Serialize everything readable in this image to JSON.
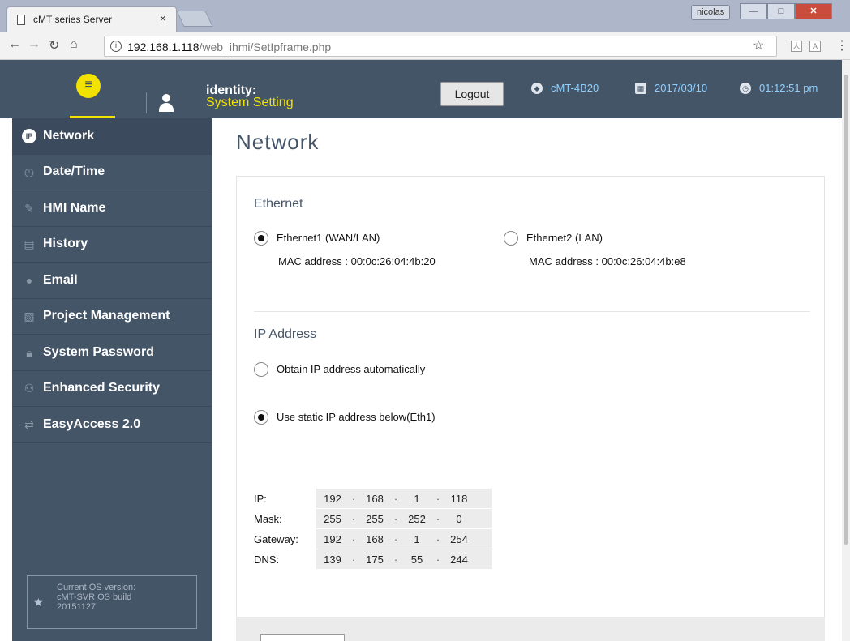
{
  "browser": {
    "tab_title": "cMT series Server",
    "tab_close": "×",
    "user_chip": "nicolas",
    "url_host": "192.168.1.118",
    "url_path": "/web_ihmi/SetIpframe.php",
    "ext1": "人",
    "ext2": "A"
  },
  "header": {
    "identity_label": "identity:",
    "identity_value": "System Setting",
    "logout_label": "Logout",
    "device_name": "cMT-4B20",
    "date": "2017/03/10",
    "time": "01:12:51 pm",
    "accent_color": "#f1e200",
    "header_bg": "#455568"
  },
  "sidebar": {
    "items": [
      {
        "label": "Network",
        "icon": "ip-icon"
      },
      {
        "label": "Date/Time",
        "icon": "clock-icon"
      },
      {
        "label": "HMI Name",
        "icon": "pencil-icon"
      },
      {
        "label": "History",
        "icon": "document-icon"
      },
      {
        "label": "Email",
        "icon": "users-icon"
      },
      {
        "label": "Project Management",
        "icon": "project-icon"
      },
      {
        "label": "System Password",
        "icon": "lock-icon"
      },
      {
        "label": "Enhanced Security",
        "icon": "security-icon"
      },
      {
        "label": "EasyAccess 2.0",
        "icon": "easyaccess-icon"
      }
    ],
    "os_line1": "Current OS version:",
    "os_line2": "cMT-SVR OS build",
    "os_line3": "20151127"
  },
  "main": {
    "page_title": "Network",
    "ethernet_title": "Ethernet",
    "eth1_label": "Ethernet1 (WAN/LAN)",
    "eth1_mac": "MAC address : 00:0c:26:04:4b:20",
    "eth2_label": "Ethernet2 (LAN)",
    "eth2_mac": "MAC address : 00:0c:26:04:4b:e8",
    "ip_title": "IP Address",
    "auto_label": "Obtain IP address automatically",
    "static_label": "Use static IP address below(Eth1)",
    "fields": [
      {
        "label": "IP:",
        "octets": [
          "192",
          "168",
          "1",
          "118"
        ]
      },
      {
        "label": "Mask:",
        "octets": [
          "255",
          "255",
          "252",
          "0"
        ]
      },
      {
        "label": "Gateway:",
        "octets": [
          "192",
          "168",
          "1",
          "254"
        ]
      },
      {
        "label": "DNS:",
        "octets": [
          "139",
          "175",
          "55",
          "244"
        ]
      }
    ]
  }
}
